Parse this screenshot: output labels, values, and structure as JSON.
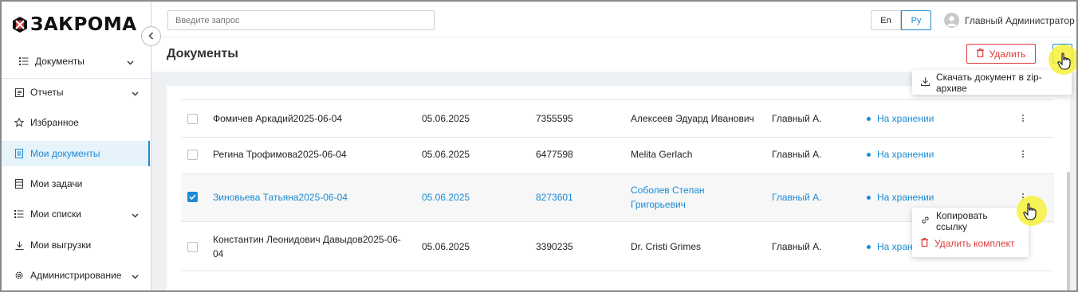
{
  "brand": {
    "name": "ЗАКРОМА"
  },
  "sidebar": {
    "items": [
      {
        "label": "Документы",
        "icon": "list-icon",
        "expandable": true
      },
      {
        "label": "Отчеты",
        "icon": "report-icon",
        "expandable": true
      },
      {
        "label": "Избранное",
        "icon": "star-icon",
        "expandable": false
      },
      {
        "label": "Мои документы",
        "icon": "document-icon",
        "expandable": false,
        "active": true
      },
      {
        "label": "Мои задачи",
        "icon": "tasks-icon",
        "expandable": false
      },
      {
        "label": "Мои списки",
        "icon": "list-icon",
        "expandable": true
      },
      {
        "label": "Мои выгрузки",
        "icon": "download-icon",
        "expandable": false
      },
      {
        "label": "Администрирование",
        "icon": "gear-icon",
        "expandable": true
      }
    ]
  },
  "topbar": {
    "search_placeholder": "Введите запрос",
    "lang_en": "En",
    "lang_ru": "Ру",
    "user_name": "Главный Администратор"
  },
  "page": {
    "title": "Документы",
    "delete_label": "Удалить"
  },
  "header_menu": {
    "download_zip": "Скачать документ в zip-архиве"
  },
  "row_menu": {
    "copy_link": "Копировать ссылку",
    "delete_set": "Удалить комплект"
  },
  "table": {
    "rows": [
      {
        "name": "Фомичев Аркадий2025-06-04",
        "date": "05.06.2025",
        "number": "7355595",
        "person": "Алексеев Эдуард Иванович",
        "owner": "Главный А.",
        "status": "На хранении",
        "checked": false
      },
      {
        "name": "Регина Трофимова2025-06-04",
        "date": "05.06.2025",
        "number": "6477598",
        "person": "Melita Gerlach",
        "owner": "Главный А.",
        "status": "На хранении",
        "checked": false
      },
      {
        "name": "Зиновьева Татьяна2025-06-04",
        "date": "05.06.2025",
        "number": "8273601",
        "person": "Соболев Степан Григорьевич",
        "owner": "Главный А.",
        "status": "На хранении",
        "checked": true
      },
      {
        "name": "Константин Леонидович Давыдов2025-06-04",
        "date": "05.06.2025",
        "number": "3390235",
        "person": "Dr. Cristi Grimes",
        "owner": "Главный А.",
        "status": "На хранении",
        "checked": false
      }
    ]
  }
}
